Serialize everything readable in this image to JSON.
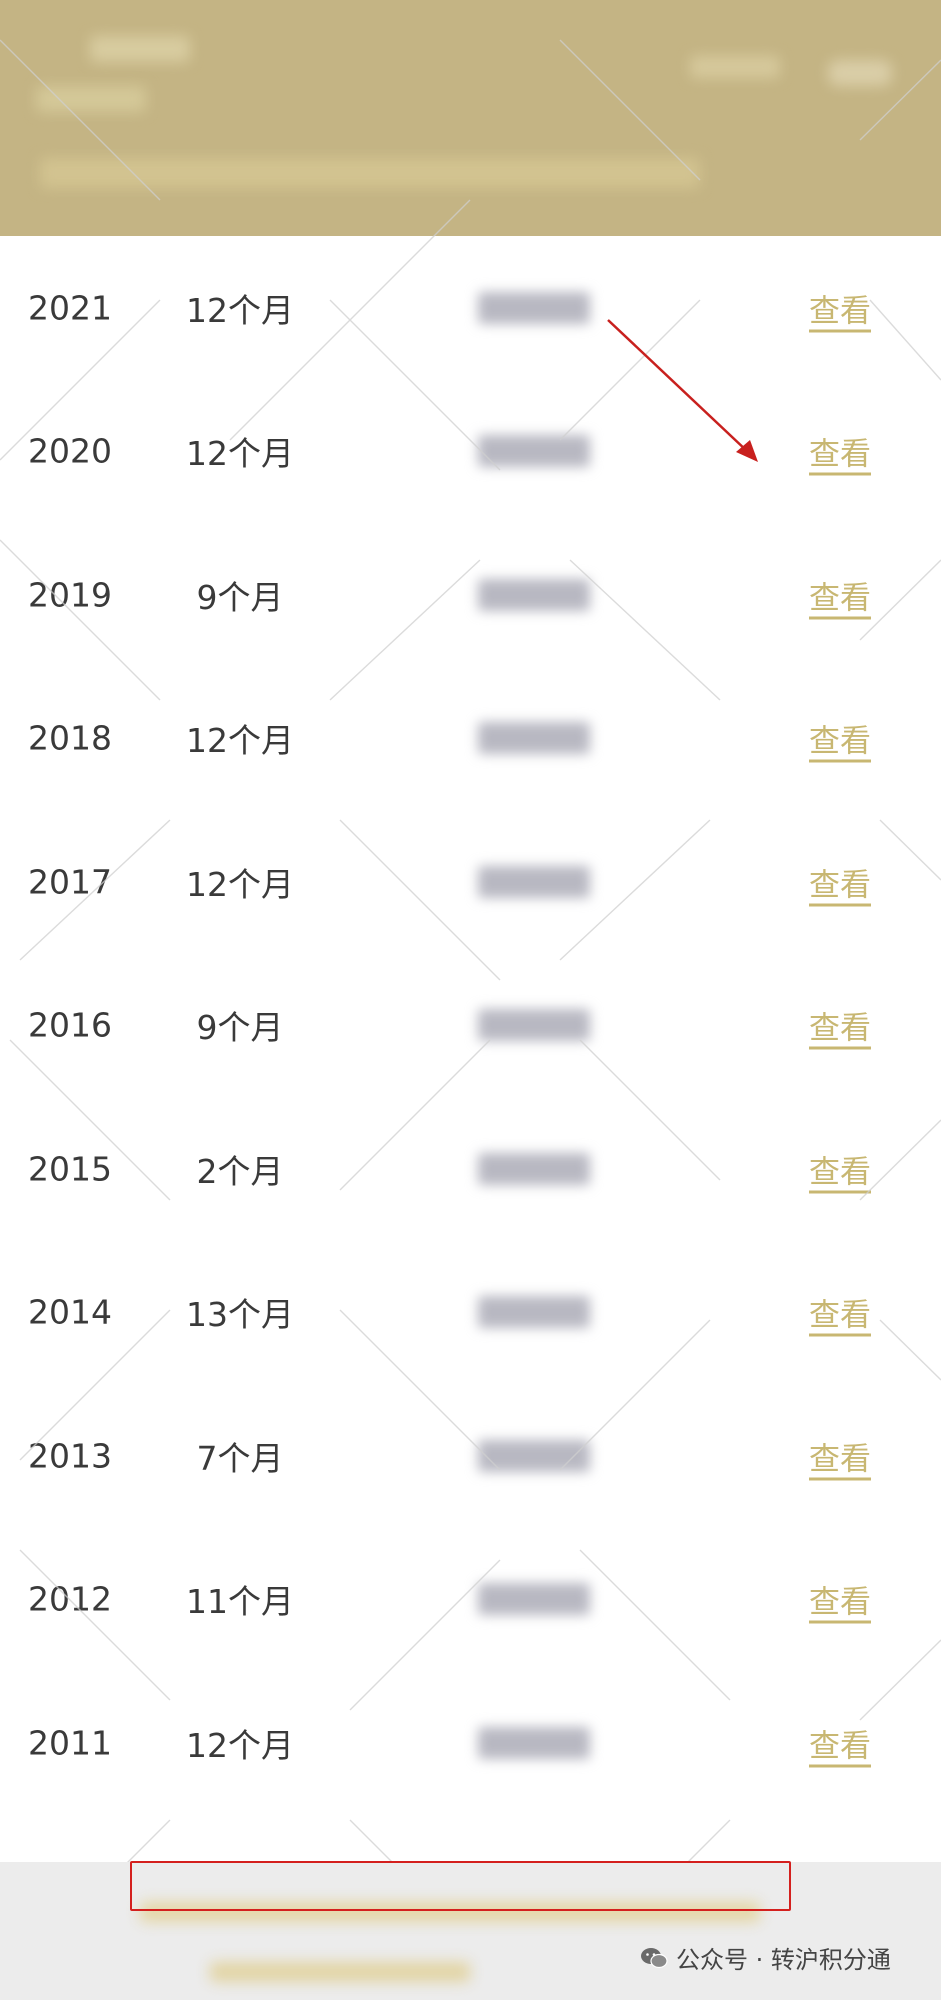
{
  "colors": {
    "header_background": "#c4b484",
    "link_color": "#c8b772",
    "highlight_border": "#d4201e"
  },
  "records": [
    {
      "year": "2021",
      "months": "12个月",
      "link": "查看"
    },
    {
      "year": "2020",
      "months": "12个月",
      "link": "查看"
    },
    {
      "year": "2019",
      "months": "9个月",
      "link": "查看"
    },
    {
      "year": "2018",
      "months": "12个月",
      "link": "查看"
    },
    {
      "year": "2017",
      "months": "12个月",
      "link": "查看"
    },
    {
      "year": "2016",
      "months": "9个月",
      "link": "查看"
    },
    {
      "year": "2015",
      "months": "2个月",
      "link": "查看"
    },
    {
      "year": "2014",
      "months": "13个月",
      "link": "查看"
    },
    {
      "year": "2013",
      "months": "7个月",
      "link": "查看"
    },
    {
      "year": "2012",
      "months": "11个月",
      "link": "查看"
    },
    {
      "year": "2011",
      "months": "12个月",
      "link": "查看"
    }
  ],
  "watermark": {
    "account_label": "公众号 · 转沪积分通",
    "icon": "wechat-icon"
  }
}
